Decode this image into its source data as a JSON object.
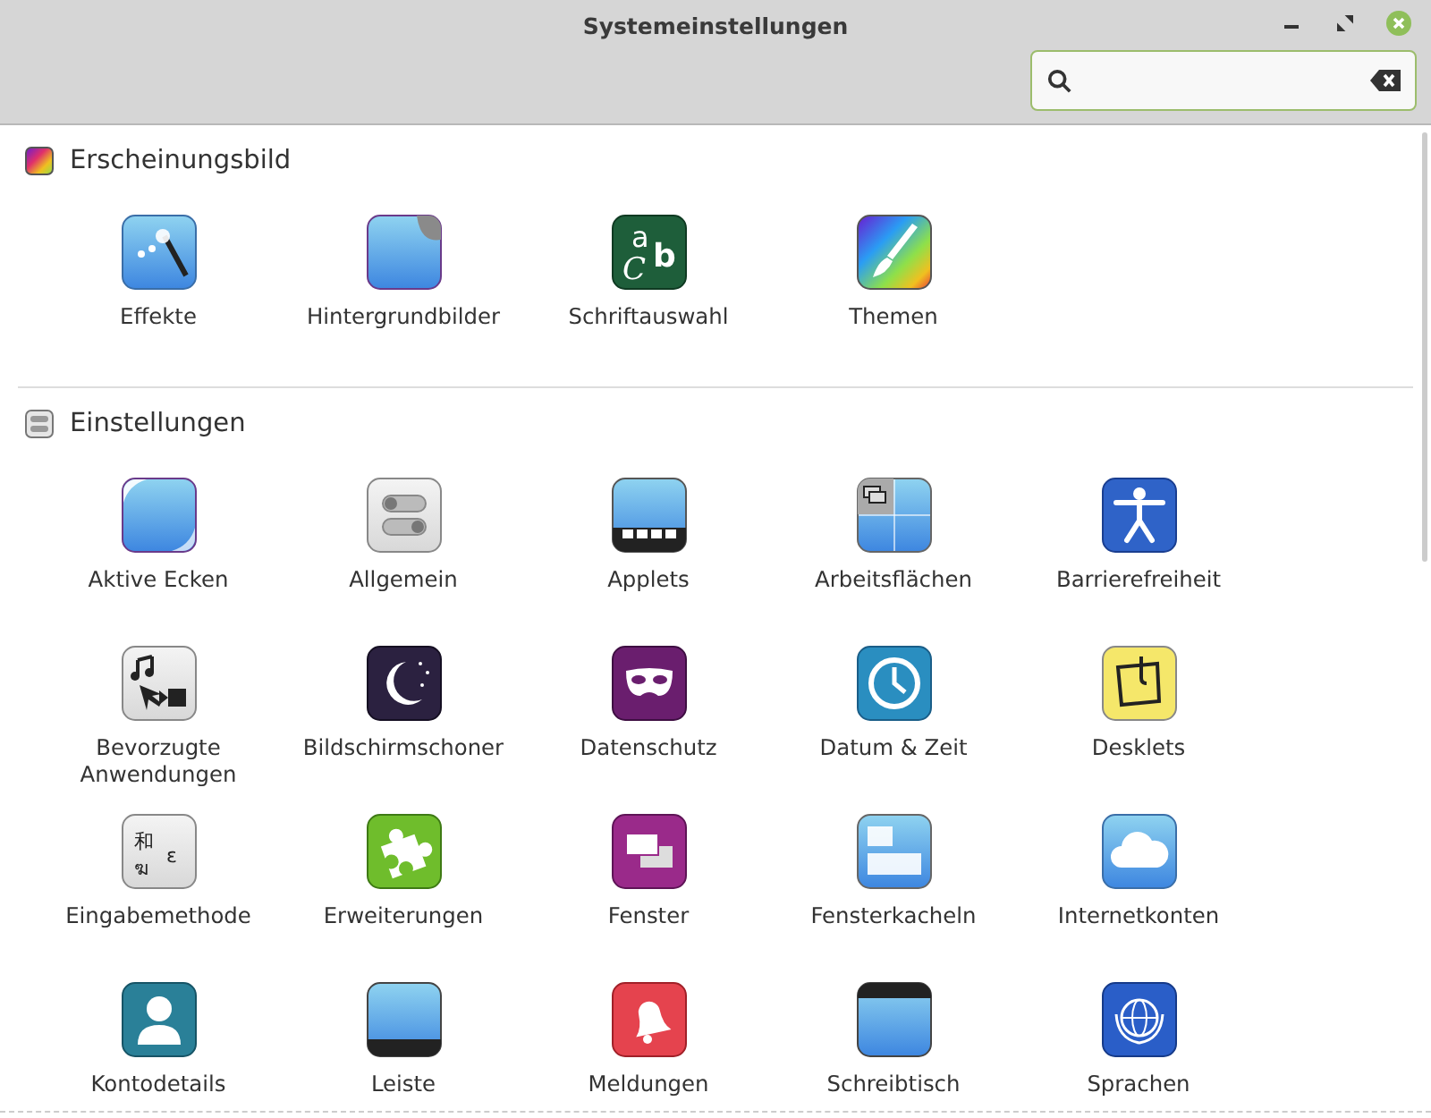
{
  "window": {
    "title": "Systemeinstellungen"
  },
  "sections": [
    {
      "title": "Erscheinungsbild",
      "kind": "appearance",
      "items": [
        {
          "label": "Effekte",
          "kind": "effects"
        },
        {
          "label": "Hintergrundbilder",
          "kind": "backgrounds"
        },
        {
          "label": "Schriftauswahl",
          "kind": "fonts",
          "glyphs": [
            "a",
            "C",
            "b"
          ]
        },
        {
          "label": "Themen",
          "kind": "themes"
        }
      ]
    },
    {
      "title": "Einstellungen",
      "kind": "preferences",
      "items": [
        {
          "label": "Aktive Ecken",
          "kind": "hotcorner"
        },
        {
          "label": "Allgemein",
          "kind": "general"
        },
        {
          "label": "Applets",
          "kind": "applets"
        },
        {
          "label": "Arbeitsflächen",
          "kind": "workspaces"
        },
        {
          "label": "Barrierefreiheit",
          "kind": "accessibility"
        },
        {
          "label": "Bevorzugte Anwendungen",
          "kind": "apps"
        },
        {
          "label": "Bildschirmschoner",
          "kind": "screensaver"
        },
        {
          "label": "Datenschutz",
          "kind": "privacy"
        },
        {
          "label": "Datum & Zeit",
          "kind": "clock"
        },
        {
          "label": "Desklets",
          "kind": "desklets"
        },
        {
          "label": "Eingabemethode",
          "kind": "input",
          "glyphs": [
            "和",
            "ฆ",
            "ε"
          ]
        },
        {
          "label": "Erweiterungen",
          "kind": "extensions"
        },
        {
          "label": "Fenster",
          "kind": "windows"
        },
        {
          "label": "Fensterkacheln",
          "kind": "tiling"
        },
        {
          "label": "Internetkonten",
          "kind": "accounts"
        },
        {
          "label": "Kontodetails",
          "kind": "user"
        },
        {
          "label": "Leiste",
          "kind": "panel"
        },
        {
          "label": "Meldungen",
          "kind": "notifications"
        },
        {
          "label": "Schreibtisch",
          "kind": "desktop"
        },
        {
          "label": "Sprachen",
          "kind": "languages"
        }
      ]
    }
  ]
}
